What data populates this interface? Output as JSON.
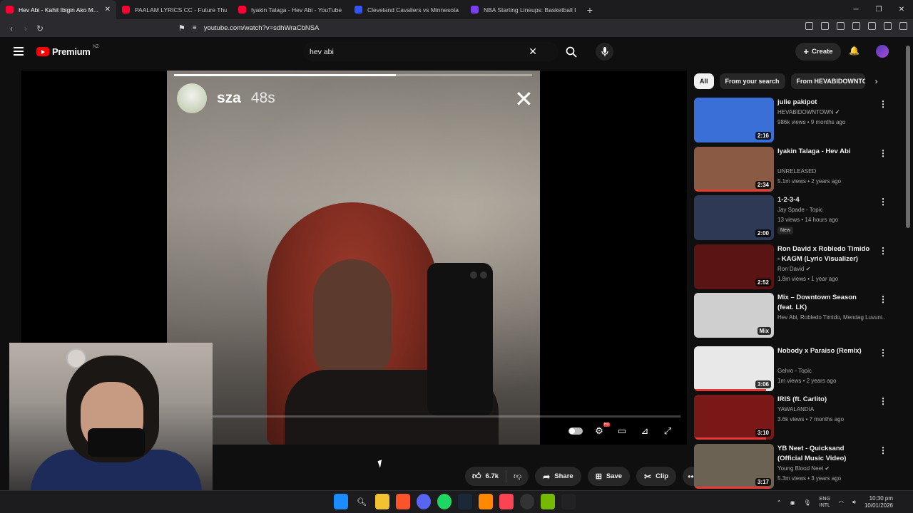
{
  "tabs": [
    {
      "title": "Hev Abi - Kahit Ibigin Ako M...",
      "color": "#ff0033",
      "active": true
    },
    {
      "title": "PAALAM LYRICS CC - Future Thug ft...",
      "color": "#ff0033",
      "active": false
    },
    {
      "title": "Iyakin Talaga - Hev Abi - YouTube",
      "color": "#ff0033",
      "active": false
    },
    {
      "title": "Cleveland Cavaliers vs Minnesota Tim...",
      "color": "#3355ff",
      "active": false
    },
    {
      "title": "NBA Starting Lineups: Basketball Da...",
      "color": "#7b3ff2",
      "active": false
    }
  ],
  "browser": {
    "url": "youtube.com/watch?v=sdhWraCbNSA"
  },
  "youtube": {
    "logo_text": "Premium",
    "region": "NZ",
    "search_query": "hev abi",
    "create_label": "Create"
  },
  "story": {
    "username": "sza",
    "elapsed": "48s",
    "progress_fraction": 0.62
  },
  "player": {
    "progress_fraction": 0.0
  },
  "actions": {
    "likes": "6.7k",
    "share": "Share",
    "save": "Save",
    "clip": "Clip"
  },
  "chips": [
    "All",
    "From your search",
    "From HEVABIDOWNTO"
  ],
  "recommendations": [
    {
      "title": "julie pakipot",
      "channel": "HEVABIDOWNTOWN",
      "verified": true,
      "meta": "986k views • 9 months ago",
      "duration": "2:16",
      "thumb": "#3a6fd8",
      "progress": 0,
      "badge": ""
    },
    {
      "title": "Iyakin Talaga - Hev Abi",
      "channel": "UNRELEASED",
      "verified": false,
      "meta": "5.1m views • 2 years ago",
      "duration": "2:34",
      "thumb": "#8a5a44",
      "progress": 0.95,
      "badge": ""
    },
    {
      "title": "1-2-3-4",
      "channel": "Jay Spade - Topic",
      "verified": false,
      "meta": "13 views • 14 hours ago",
      "duration": "2:00",
      "thumb": "#2e3a55",
      "progress": 0,
      "badge": "New"
    },
    {
      "title": "Ron David x Robledo Timido - KAGM (Lyric Visualizer)",
      "channel": "Ron David",
      "verified": true,
      "meta": "1.8m views • 1 year ago",
      "duration": "2:52",
      "thumb": "#5a1414",
      "progress": 0,
      "badge": ""
    },
    {
      "title": "Mix – Downtown Season (feat. LK)",
      "channel": "Hev Abi, Robledo Timido, Mendag Luvuni...",
      "verified": false,
      "meta": "",
      "duration": "Mix",
      "thumb": "#cfcfcf",
      "progress": 0,
      "badge": ""
    },
    {
      "title": "Nobody x Paraiso (Remix)",
      "channel": "Gehro - Topic",
      "verified": false,
      "meta": "1m views • 2 years ago",
      "duration": "3:06",
      "thumb": "#e8e8e8",
      "progress": 0.9,
      "badge": ""
    },
    {
      "title": "IRIS (ft. Carlito)",
      "channel": "YAWALANDIA",
      "verified": false,
      "meta": "3.6k views • 7 months ago",
      "duration": "3:10",
      "thumb": "#7a1818",
      "progress": 0.9,
      "badge": ""
    },
    {
      "title": "YB Neet - Quicksand (Official Music Video)",
      "channel": "Young Blood Neet",
      "verified": true,
      "meta": "5.3m views • 3 years ago",
      "duration": "3:17",
      "thumb": "#6b6253",
      "progress": 0.95,
      "badge": ""
    }
  ],
  "taskbar": {
    "lang_line1": "ENG",
    "lang_line2": "INTL",
    "time": "10:30 pm",
    "date": "10/01/2026"
  }
}
